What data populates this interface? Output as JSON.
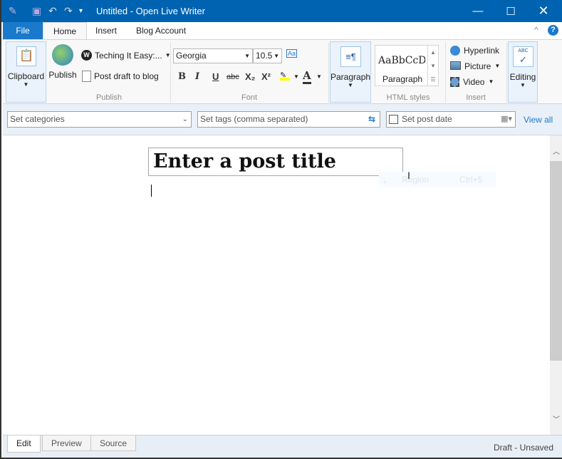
{
  "window": {
    "title": "Untitled - Open Live Writer"
  },
  "menu_tabs": [
    "File",
    "Home",
    "Insert",
    "Blog Account"
  ],
  "ribbon": {
    "clipboard": {
      "label": "Clipboard"
    },
    "publish": {
      "publish_label": "Publish",
      "blog_name": "Teching It Easy:...",
      "post_draft": "Post draft to blog",
      "group": "Publish"
    },
    "font": {
      "family": "Georgia",
      "size": "10.5",
      "group": "Font",
      "bold": "B",
      "italic": "I",
      "underline": "U",
      "strike": "abc",
      "sub": "X₂",
      "sup": "X²",
      "color": "A",
      "highlight_color": "#ffff00"
    },
    "paragraph": {
      "label": "Paragraph"
    },
    "styles": {
      "preview": "AaBbCcDc",
      "name": "Paragraph",
      "group": "HTML styles"
    },
    "insert": {
      "hyperlink": "Hyperlink",
      "picture": "Picture",
      "video": "Video",
      "group": "Insert"
    },
    "editing": {
      "label": "Editing"
    }
  },
  "post_bar": {
    "categories_placeholder": "Set categories",
    "tags_placeholder": "Set tags (comma separated)",
    "post_date": "Set post date",
    "view_all": "View all"
  },
  "editor": {
    "title_placeholder": "Enter a post title",
    "ghost_menu_label": "Region",
    "ghost_menu_shortcut": "Ctrl+5"
  },
  "bottom_tabs": [
    "Edit",
    "Preview",
    "Source"
  ],
  "status": "Draft - Unsaved",
  "colors": {
    "titlebar": "#0063b1",
    "file_tab": "#1979ca",
    "link": "#1979ca"
  }
}
